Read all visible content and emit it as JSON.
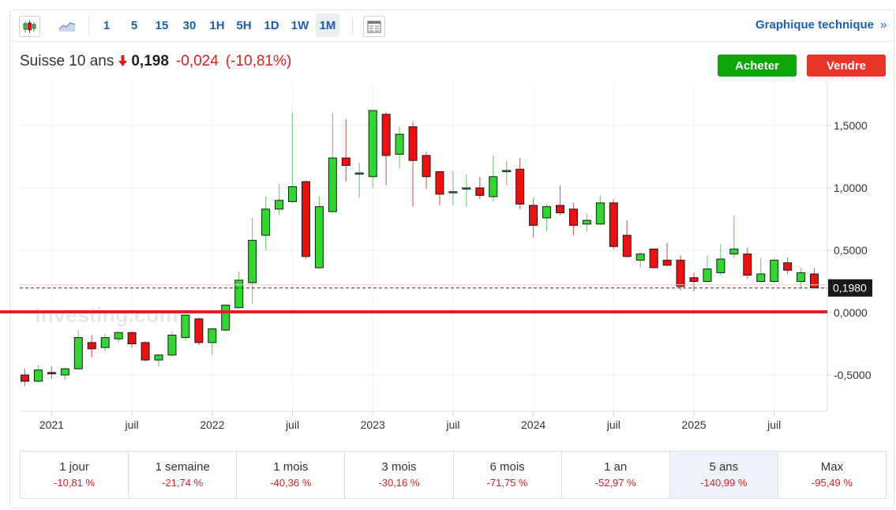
{
  "toolbar": {
    "intervals": [
      "1",
      "5",
      "15",
      "30",
      "1H",
      "5H",
      "1D",
      "1W",
      "1M"
    ],
    "selected_interval": "1M",
    "technical_link": "Graphique technique",
    "technical_chevron": "»",
    "icons": [
      "candlestick-icon",
      "area-chart-icon",
      "table-view-icon"
    ]
  },
  "quote": {
    "name": "Suisse 10 ans",
    "direction_icon": "down-arrow-icon",
    "last": "0,198",
    "change": "-0,024",
    "change_pct": "(-10,81%)"
  },
  "actions": {
    "buy": "Acheter",
    "sell": "Vendre"
  },
  "colors": {
    "up": "#2ed82e",
    "down": "#ee0f0f",
    "accent": "#1b5fb3",
    "buy": "#0ea60b",
    "sell": "#e8342a"
  },
  "watermark": "Investing.com",
  "chart_data": {
    "type": "candlestick",
    "x_labels": [
      "2021",
      "juil",
      "2022",
      "juil",
      "2023",
      "juil",
      "2024",
      "juil",
      "2025",
      "juil"
    ],
    "y_ticks": [
      "1,5000",
      "1,0000",
      "0,5000",
      "0,0000",
      "-0,5000"
    ],
    "y_tick_values": [
      1.5,
      1.0,
      0.5,
      0.0,
      -0.5
    ],
    "ylim": [
      -0.78,
      1.75
    ],
    "last_price_label": "0,1980",
    "last_price": 0.198,
    "zero_line": 0,
    "grid": true,
    "candles": [
      {
        "date": "2020-11",
        "o": -0.5,
        "h": -0.45,
        "l": -0.59,
        "c": -0.55
      },
      {
        "date": "2020-12",
        "o": -0.55,
        "h": -0.42,
        "l": -0.56,
        "c": -0.46
      },
      {
        "date": "2021-01",
        "o": -0.48,
        "h": -0.43,
        "l": -0.53,
        "c": -0.49
      },
      {
        "date": "2021-02",
        "o": -0.5,
        "h": -0.44,
        "l": -0.54,
        "c": -0.45
      },
      {
        "date": "2021-03",
        "o": -0.45,
        "h": -0.14,
        "l": -0.46,
        "c": -0.2
      },
      {
        "date": "2021-04",
        "o": -0.24,
        "h": -0.18,
        "l": -0.36,
        "c": -0.29
      },
      {
        "date": "2021-05",
        "o": -0.28,
        "h": -0.17,
        "l": -0.31,
        "c": -0.2
      },
      {
        "date": "2021-06",
        "o": -0.21,
        "h": -0.15,
        "l": -0.24,
        "c": -0.16
      },
      {
        "date": "2021-07",
        "o": -0.16,
        "h": -0.15,
        "l": -0.28,
        "c": -0.25
      },
      {
        "date": "2021-08",
        "o": -0.24,
        "h": -0.23,
        "l": -0.39,
        "c": -0.38
      },
      {
        "date": "2021-09",
        "o": -0.38,
        "h": -0.33,
        "l": -0.43,
        "c": -0.34
      },
      {
        "date": "2021-10",
        "o": -0.34,
        "h": -0.15,
        "l": -0.35,
        "c": -0.18
      },
      {
        "date": "2021-11",
        "o": -0.2,
        "h": -0.02,
        "l": -0.22,
        "c": -0.02
      },
      {
        "date": "2021-12",
        "o": -0.05,
        "h": -0.04,
        "l": -0.26,
        "c": -0.24
      },
      {
        "date": "2022-01",
        "o": -0.24,
        "h": -0.18,
        "l": -0.34,
        "c": -0.13
      },
      {
        "date": "2022-02",
        "o": -0.14,
        "h": 0.07,
        "l": -0.15,
        "c": 0.06
      },
      {
        "date": "2022-03",
        "o": 0.04,
        "h": 0.33,
        "l": 0.03,
        "c": 0.26
      },
      {
        "date": "2022-04",
        "o": 0.24,
        "h": 0.76,
        "l": 0.07,
        "c": 0.58
      },
      {
        "date": "2022-05",
        "o": 0.62,
        "h": 0.93,
        "l": 0.5,
        "c": 0.83
      },
      {
        "date": "2022-06",
        "o": 0.83,
        "h": 1.03,
        "l": 0.78,
        "c": 0.9
      },
      {
        "date": "2022-07",
        "o": 0.89,
        "h": 1.6,
        "l": 0.88,
        "c": 1.01
      },
      {
        "date": "2022-08",
        "o": 1.05,
        "h": 1.06,
        "l": 0.43,
        "c": 0.45
      },
      {
        "date": "2022-09",
        "o": 0.36,
        "h": 0.93,
        "l": 0.35,
        "c": 0.85
      },
      {
        "date": "2022-10",
        "o": 0.81,
        "h": 1.6,
        "l": 0.8,
        "c": 1.24
      },
      {
        "date": "2022-11",
        "o": 1.24,
        "h": 1.55,
        "l": 1.05,
        "c": 1.18
      },
      {
        "date": "2022-12",
        "o": 1.11,
        "h": 1.2,
        "l": 0.92,
        "c": 1.12
      },
      {
        "date": "2022-12b",
        "o": 1.09,
        "h": 1.62,
        "l": 1.0,
        "c": 1.62
      },
      {
        "date": "2023-02",
        "o": 1.59,
        "h": 1.61,
        "l": 1.02,
        "c": 1.26
      },
      {
        "date": "2023-03",
        "o": 1.27,
        "h": 1.49,
        "l": 1.16,
        "c": 1.43
      },
      {
        "date": "2023-04",
        "o": 1.49,
        "h": 1.53,
        "l": 0.85,
        "c": 1.22
      },
      {
        "date": "2023-05",
        "o": 1.26,
        "h": 1.29,
        "l": 0.99,
        "c": 1.09
      },
      {
        "date": "2023-06",
        "o": 1.13,
        "h": 1.13,
        "l": 0.86,
        "c": 0.95
      },
      {
        "date": "2023-07",
        "o": 0.97,
        "h": 1.14,
        "l": 0.86,
        "c": 0.97
      },
      {
        "date": "2023-08",
        "o": 0.99,
        "h": 1.11,
        "l": 0.85,
        "c": 1.0
      },
      {
        "date": "2023-09",
        "o": 1.0,
        "h": 1.09,
        "l": 0.91,
        "c": 0.94
      },
      {
        "date": "2023-10",
        "o": 0.93,
        "h": 1.26,
        "l": 0.89,
        "c": 1.09
      },
      {
        "date": "2023-11",
        "o": 1.13,
        "h": 1.22,
        "l": 1.02,
        "c": 1.14
      },
      {
        "date": "2023-12",
        "o": 1.15,
        "h": 1.24,
        "l": 0.83,
        "c": 0.87
      },
      {
        "date": "2024-01",
        "o": 0.86,
        "h": 0.92,
        "l": 0.6,
        "c": 0.7
      },
      {
        "date": "2024-02",
        "o": 0.76,
        "h": 0.87,
        "l": 0.65,
        "c": 0.85
      },
      {
        "date": "2024-03",
        "o": 0.86,
        "h": 1.02,
        "l": 0.78,
        "c": 0.8
      },
      {
        "date": "2024-04",
        "o": 0.83,
        "h": 0.88,
        "l": 0.62,
        "c": 0.7
      },
      {
        "date": "2024-05",
        "o": 0.71,
        "h": 0.8,
        "l": 0.65,
        "c": 0.74
      },
      {
        "date": "2024-06",
        "o": 0.71,
        "h": 0.94,
        "l": 0.7,
        "c": 0.88
      },
      {
        "date": "2024-07",
        "o": 0.88,
        "h": 0.91,
        "l": 0.51,
        "c": 0.53
      },
      {
        "date": "2024-08",
        "o": 0.62,
        "h": 0.74,
        "l": 0.44,
        "c": 0.45
      },
      {
        "date": "2024-09",
        "o": 0.42,
        "h": 0.49,
        "l": 0.36,
        "c": 0.47
      },
      {
        "date": "2024-10",
        "o": 0.51,
        "h": 0.51,
        "l": 0.36,
        "c": 0.36
      },
      {
        "date": "2024-11",
        "o": 0.42,
        "h": 0.56,
        "l": 0.37,
        "c": 0.38
      },
      {
        "date": "2024-12",
        "o": 0.42,
        "h": 0.46,
        "l": 0.18,
        "c": 0.21
      },
      {
        "date": "2025-01",
        "o": 0.28,
        "h": 0.32,
        "l": 0.17,
        "c": 0.25
      },
      {
        "date": "2025-02",
        "o": 0.25,
        "h": 0.46,
        "l": 0.24,
        "c": 0.35
      },
      {
        "date": "2025-03",
        "o": 0.32,
        "h": 0.55,
        "l": 0.3,
        "c": 0.43
      },
      {
        "date": "2025-04",
        "o": 0.47,
        "h": 0.78,
        "l": 0.44,
        "c": 0.51
      },
      {
        "date": "2025-05",
        "o": 0.47,
        "h": 0.52,
        "l": 0.27,
        "c": 0.3
      },
      {
        "date": "2025-06",
        "o": 0.25,
        "h": 0.44,
        "l": 0.24,
        "c": 0.31
      },
      {
        "date": "2025-07",
        "o": 0.25,
        "h": 0.44,
        "l": 0.24,
        "c": 0.42
      },
      {
        "date": "2025-08",
        "o": 0.4,
        "h": 0.44,
        "l": 0.31,
        "c": 0.34
      },
      {
        "date": "2025-09",
        "o": 0.25,
        "h": 0.36,
        "l": 0.2,
        "c": 0.32
      },
      {
        "date": "2025-10",
        "o": 0.31,
        "h": 0.36,
        "l": 0.19,
        "c": 0.2
      }
    ]
  },
  "performance": [
    {
      "label": "1 jour",
      "value": "-10,81 %"
    },
    {
      "label": "1 semaine",
      "value": "-21,74 %"
    },
    {
      "label": "1 mois",
      "value": "-40,36 %"
    },
    {
      "label": "3 mois",
      "value": "-30,16 %"
    },
    {
      "label": "6 mois",
      "value": "-71,75 %"
    },
    {
      "label": "1 an",
      "value": "-52,97 %"
    },
    {
      "label": "5 ans",
      "value": "-140,99 %",
      "selected": true
    },
    {
      "label": "Max",
      "value": "-95,49 %"
    }
  ]
}
